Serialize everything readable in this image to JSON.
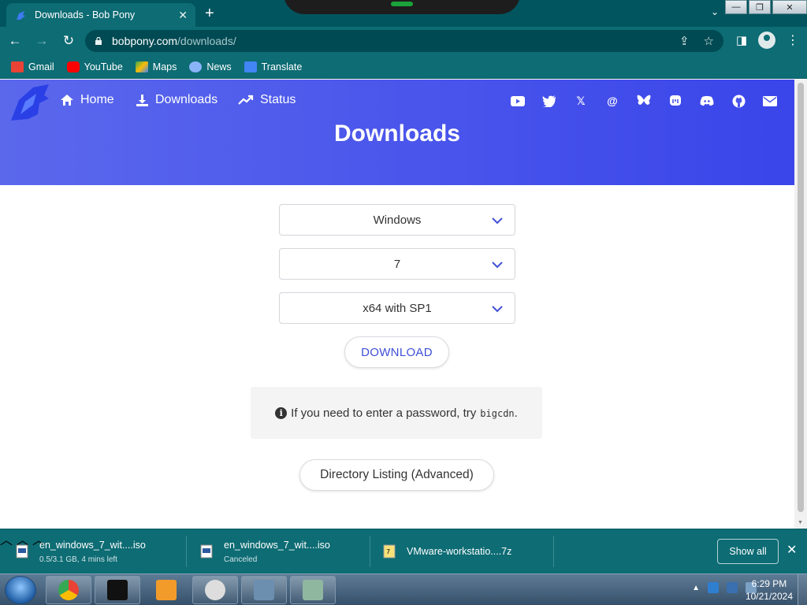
{
  "browser": {
    "tab_title": "Downloads - Bob Pony",
    "url_host": "bobpony.com",
    "url_path": "/downloads/",
    "bookmarks": [
      {
        "label": "Gmail",
        "color": "#ea4335"
      },
      {
        "label": "YouTube",
        "color": "#ff0000"
      },
      {
        "label": "Maps",
        "color": "#34a853"
      },
      {
        "label": "News",
        "color": "#4285f4"
      },
      {
        "label": "Translate",
        "color": "#4285f4"
      }
    ]
  },
  "site": {
    "nav": [
      {
        "label": "Home",
        "icon": "home-icon"
      },
      {
        "label": "Downloads",
        "icon": "download-icon"
      },
      {
        "label": "Status",
        "icon": "trend-icon"
      }
    ],
    "socials": [
      "youtube-icon",
      "twitter-icon",
      "x-icon",
      "threads-icon",
      "bluesky-icon",
      "mastodon-icon",
      "discord-icon",
      "github-icon",
      "mail-icon"
    ],
    "heading": "Downloads",
    "brand_color": "#4b57ea"
  },
  "form": {
    "os": "Windows",
    "version": "7",
    "edition": "x64 with SP1",
    "download_label": "DOWNLOAD",
    "notice_text": "If you need to enter a password, try",
    "notice_code": "bigcdn",
    "notice_end": ".",
    "directory_label": "Directory Listing (Advanced)"
  },
  "downloads": {
    "items": [
      {
        "name": "en_windows_7_wit....iso",
        "status": "0.5/3.1 GB, 4 mins left"
      },
      {
        "name": "en_windows_7_wit....iso",
        "status": "Canceled"
      },
      {
        "name": "VMware-workstatio....7z",
        "status": ""
      }
    ],
    "show_all": "Show all"
  },
  "taskbar": {
    "time": "6:29 PM",
    "date": "10/21/2024"
  }
}
